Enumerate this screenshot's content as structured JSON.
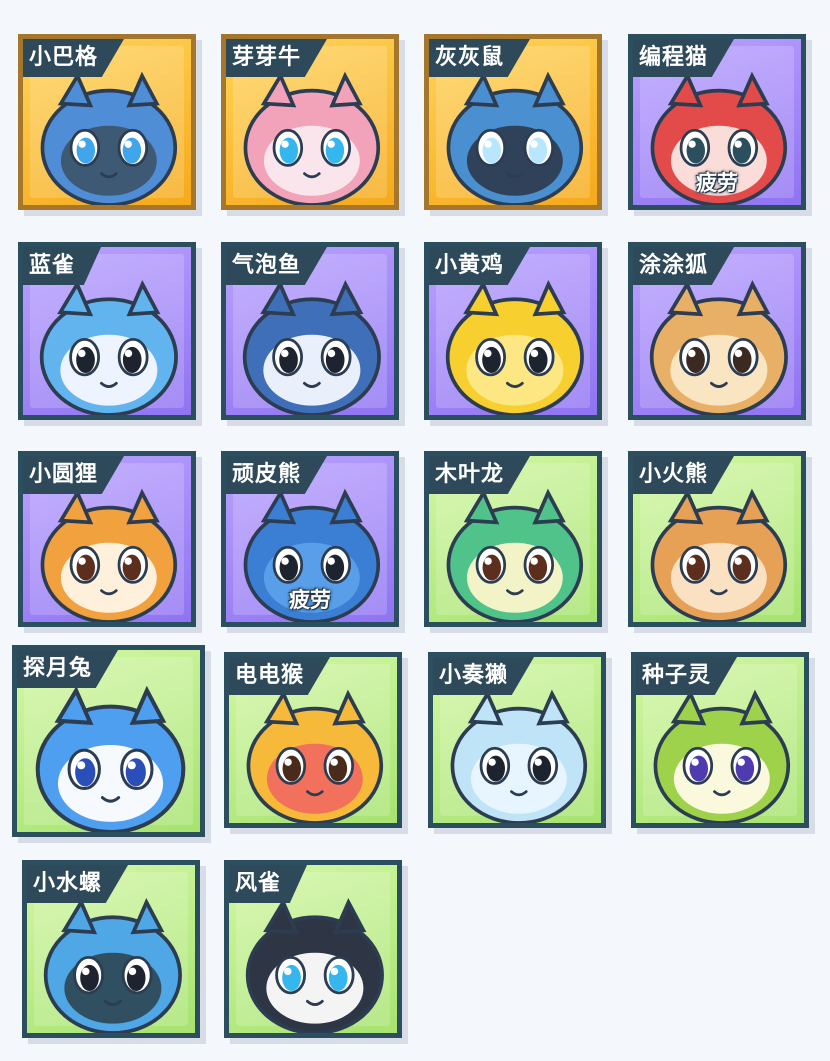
{
  "pets": [
    {
      "name": "小巴格",
      "rarity": "gold",
      "status": "",
      "body": "#4f8ed6",
      "face": "#3d566e",
      "eye": "#3fa6ec",
      "icon": "frowning-blue-creature-icon"
    },
    {
      "name": "芽芽牛",
      "rarity": "gold",
      "status": "",
      "body": "#f2a3b9",
      "face": "#fbe9ef",
      "eye": "#35b6ee",
      "icon": "pink-calf-icon"
    },
    {
      "name": "灰灰鼠",
      "rarity": "gold",
      "status": "",
      "body": "#4a8fcf",
      "face": "#2e3e52",
      "eye": "#b9e6ff",
      "icon": "grey-mouse-icon"
    },
    {
      "name": "编程猫",
      "rarity": "purple",
      "status": "疲劳",
      "body": "#e34b4b",
      "face": "#fbe5e0",
      "eye": "#2c4f60",
      "icon": "red-cat-icon"
    },
    {
      "name": "蓝雀",
      "rarity": "purple",
      "status": "",
      "body": "#62b4ef",
      "face": "#f6f8ff",
      "eye": "#1d2430",
      "icon": "blue-parrot-icon"
    },
    {
      "name": "气泡鱼",
      "rarity": "purple",
      "status": "",
      "body": "#3f6fb8",
      "face": "#f3f6ff",
      "eye": "#1d2430",
      "icon": "bubble-fish-icon"
    },
    {
      "name": "小黄鸡",
      "rarity": "purple",
      "status": "",
      "body": "#f7cf2f",
      "face": "#fde887",
      "eye": "#1d2430",
      "icon": "yellow-chick-icon"
    },
    {
      "name": "涂涂狐",
      "rarity": "purple",
      "status": "",
      "body": "#e8b066",
      "face": "#fbe8c8",
      "eye": "#3b2a22",
      "icon": "fox-icon"
    },
    {
      "name": "小圆狸",
      "rarity": "purple",
      "status": "",
      "body": "#f2a13f",
      "face": "#fff4e4",
      "eye": "#5b2e1e",
      "icon": "raccoon-icon"
    },
    {
      "name": "顽皮熊",
      "rarity": "purple",
      "status": "疲劳",
      "body": "#3a7fd3",
      "face": "#5aa0ea",
      "eye": "#1d2430",
      "icon": "blue-bear-icon"
    },
    {
      "name": "木叶龙",
      "rarity": "green",
      "status": "",
      "body": "#4fc389",
      "face": "#fbf6c9",
      "eye": "#5b2e1e",
      "icon": "leaf-dragon-icon"
    },
    {
      "name": "小火熊",
      "rarity": "green",
      "status": "",
      "body": "#e6a156",
      "face": "#fbe5c8",
      "eye": "#5b2e1e",
      "icon": "fire-bear-icon"
    },
    {
      "name": "探月兔",
      "rarity": "green",
      "status": "",
      "body": "#4f9ff0",
      "face": "#ffffff",
      "eye": "#2b4fb8",
      "icon": "moon-rabbit-icon"
    },
    {
      "name": "电电猴",
      "rarity": "green",
      "status": "",
      "body": "#f6b93a",
      "face": "#f06d5e",
      "eye": "#4a2a1a",
      "icon": "electric-monkey-icon"
    },
    {
      "name": "小奏獭",
      "rarity": "green",
      "status": "",
      "body": "#bfe4f7",
      "face": "#e8f6ff",
      "eye": "#1d2430",
      "icon": "otter-icon"
    },
    {
      "name": "种子灵",
      "rarity": "green",
      "status": "",
      "body": "#9ed24a",
      "face": "#fffbe6",
      "eye": "#4e3bb0",
      "icon": "seed-spirit-icon"
    },
    {
      "name": "小水螺",
      "rarity": "green",
      "status": "",
      "body": "#4fa7e6",
      "face": "#2e4a5a",
      "eye": "#1d2430",
      "icon": "water-snail-icon"
    },
    {
      "name": "风雀",
      "rarity": "green",
      "status": "",
      "body": "#2e3545",
      "face": "#ffffff",
      "eye": "#35b6ee",
      "icon": "wind-bird-icon"
    }
  ]
}
